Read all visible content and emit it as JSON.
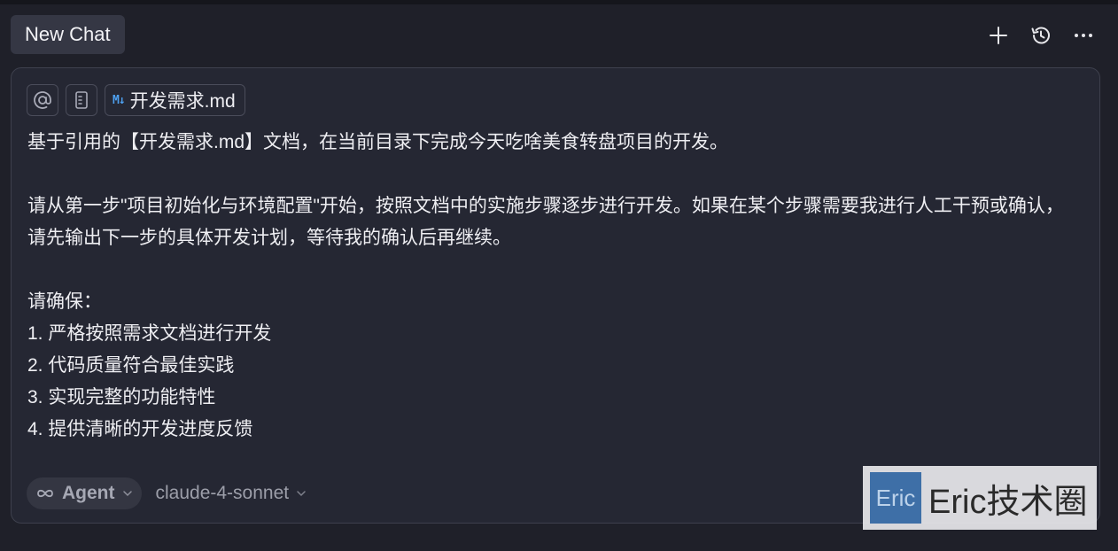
{
  "header": {
    "tab_label": "New Chat",
    "actions": [
      {
        "icon": "plus-icon"
      },
      {
        "icon": "history-icon"
      },
      {
        "icon": "more-icon"
      }
    ]
  },
  "composer": {
    "context": {
      "mention_icon": "at-icon",
      "doc_icon": "document-icon",
      "file_icon_text": "M↓",
      "file_name": "开发需求.md"
    },
    "prompt_text": "基于引用的【开发需求.md】文档，在当前目录下完成今天吃啥美食转盘项目的开发。\n\n请从第一步\"项目初始化与环境配置\"开始，按照文档中的实施步骤逐步进行开发。如果在某个步骤需要我进行人工干预或确认，请先输出下一步的具体开发计划，等待我的确认后再继续。\n\n请确保：\n1. 严格按照需求文档进行开发\n2. 代码质量符合最佳实践\n3. 实现完整的功能特性\n4. 提供清晰的开发进度反馈",
    "mode": {
      "label": "Agent",
      "icon": "infinity-icon"
    },
    "model": {
      "label": "claude-4-sonnet"
    }
  },
  "watermark": {
    "logo_text": "Eric",
    "text": "Eric技术圈"
  },
  "colors": {
    "background": "#1f2029",
    "composer_bg": "#252733",
    "accent_blue": "#4ea1f1"
  }
}
